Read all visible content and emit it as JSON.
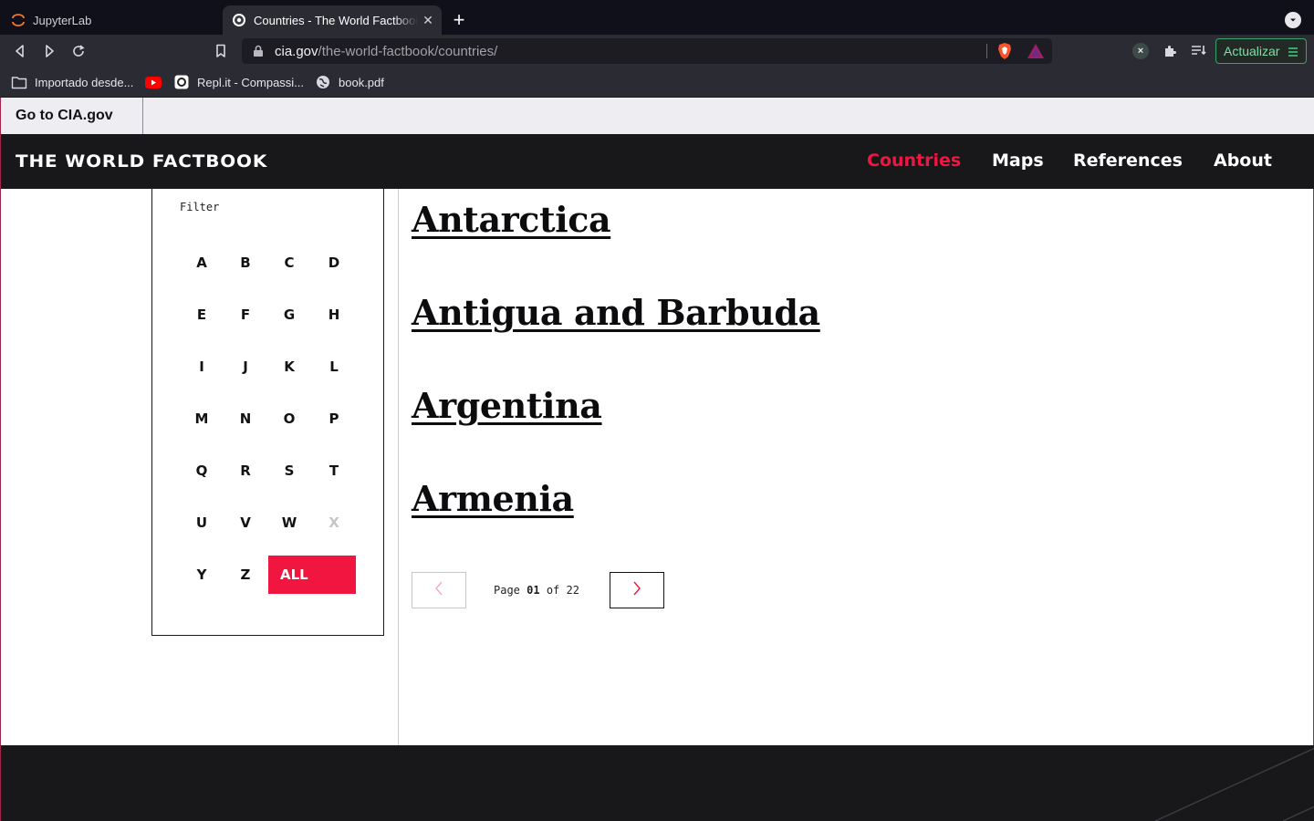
{
  "browser": {
    "tabs": [
      {
        "title": "JupyterLab",
        "icon": "jupyter-icon"
      },
      {
        "title": "Countries - The World Factbook",
        "icon": "cia-seal-icon",
        "active": true
      }
    ],
    "url_domain": "cia.gov",
    "url_path": "/the-world-factbook/countries/",
    "update_label": "Actualizar",
    "bookmarks": [
      {
        "label": "Importado desde...",
        "icon": "folder-icon"
      },
      {
        "label": "",
        "icon": "youtube-icon"
      },
      {
        "label": "Repl.it - Compassi...",
        "icon": "replit-icon"
      },
      {
        "label": "book.pdf",
        "icon": "globe-icon"
      }
    ]
  },
  "site": {
    "cia_link": "Go to CIA.gov",
    "title": "THE WORLD FACTBOOK",
    "nav": [
      "Countries",
      "Maps",
      "References",
      "About"
    ],
    "active_nav": "Countries",
    "accent_color": "#f0163f"
  },
  "filter": {
    "label": "Filter",
    "letters": [
      "A",
      "B",
      "C",
      "D",
      "E",
      "F",
      "G",
      "H",
      "I",
      "J",
      "K",
      "L",
      "M",
      "N",
      "O",
      "P",
      "Q",
      "R",
      "S",
      "T",
      "U",
      "V",
      "W",
      "X",
      "Y",
      "Z"
    ],
    "disabled_letters": [
      "X"
    ],
    "all_label": "ALL"
  },
  "countries": [
    "Antarctica",
    "Antigua and Barbuda",
    "Argentina",
    "Armenia"
  ],
  "pagination": {
    "page_word": "Page",
    "current": "01",
    "of_word": "of",
    "total": "22"
  }
}
